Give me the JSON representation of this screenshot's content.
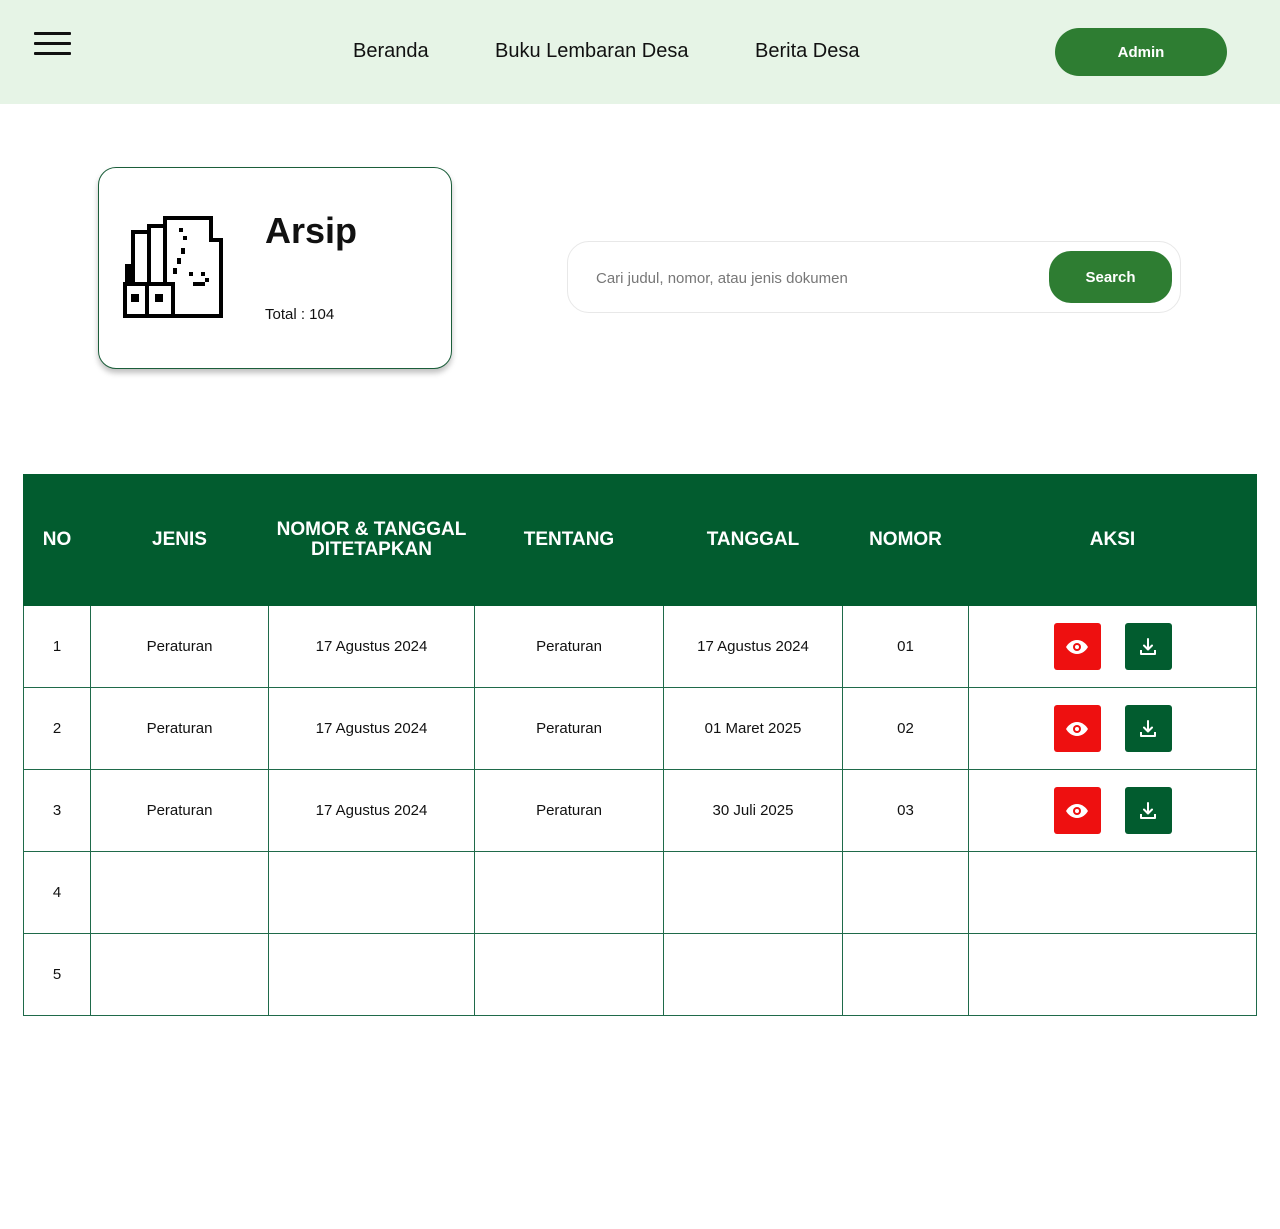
{
  "header": {
    "nav": [
      "Beranda",
      "Buku Lembaran Desa",
      "Berita Desa"
    ],
    "admin_label": "Admin"
  },
  "summary_card": {
    "title": "Arsip",
    "total_label": "Total : 104"
  },
  "search": {
    "placeholder": "Cari judul, nomor, atau jenis dokumen",
    "button_label": "Search"
  },
  "table": {
    "headers": [
      "NO",
      "JENIS",
      "NOMOR & TANGGAL DITETAPKAN",
      "TENTANG",
      "TANGGAL",
      "NOMOR",
      "AKSI"
    ],
    "rows": [
      {
        "no": "1",
        "jenis": "Peraturan",
        "nomor_tanggal": "17 Agustus 2024",
        "tentang": "Peraturan",
        "tanggal": "17 Agustus 2024",
        "nomor": "01"
      },
      {
        "no": "2",
        "jenis": "Peraturan",
        "nomor_tanggal": "17 Agustus 2024",
        "tentang": "Peraturan",
        "tanggal": "01 Maret 2025",
        "nomor": "02"
      },
      {
        "no": "3",
        "jenis": "Peraturan",
        "nomor_tanggal": "17 Agustus 2024",
        "tentang": "Peraturan",
        "tanggal": "30 Juli 2025",
        "nomor": "03"
      },
      {
        "no": "4",
        "jenis": "",
        "nomor_tanggal": "",
        "tentang": "",
        "tanggal": "",
        "nomor": ""
      },
      {
        "no": "5",
        "jenis": "",
        "nomor_tanggal": "",
        "tentang": "",
        "tanggal": "",
        "nomor": ""
      }
    ],
    "row_actions": [
      "eye-icon",
      "download-icon"
    ]
  },
  "colors": {
    "header_bg": "#e6f4e6",
    "brand_green": "#2e7d32",
    "table_header": "#025c2f",
    "view_red": "#ee1010"
  }
}
